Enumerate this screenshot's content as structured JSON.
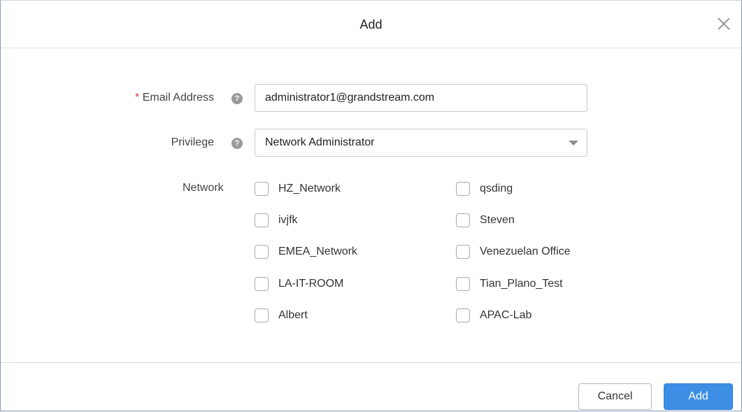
{
  "dialog": {
    "title": "Add"
  },
  "form": {
    "email": {
      "required_mark": "*",
      "label": "Email Address",
      "value": "administrator1@grandstream.com"
    },
    "privilege": {
      "label": "Privilege",
      "value": "Network Administrator"
    },
    "network": {
      "label": "Network",
      "left_column": [
        "HZ_Network",
        "ivjfk",
        "EMEA_Network",
        "LA-IT-ROOM",
        "Albert"
      ],
      "right_column": [
        "qsding",
        "Steven",
        "Venezuelan Office",
        "Tian_Plano_Test",
        "APAC-Lab"
      ]
    }
  },
  "footer": {
    "cancel_label": "Cancel",
    "add_label": "Add"
  },
  "colors": {
    "primary_button": "#3d8fe6",
    "required_mark": "#e0393e",
    "help_icon": "#9a9a9a"
  },
  "icons": {
    "close": "close-icon",
    "help": "help-icon",
    "dropdown": "chevron-down-icon"
  }
}
